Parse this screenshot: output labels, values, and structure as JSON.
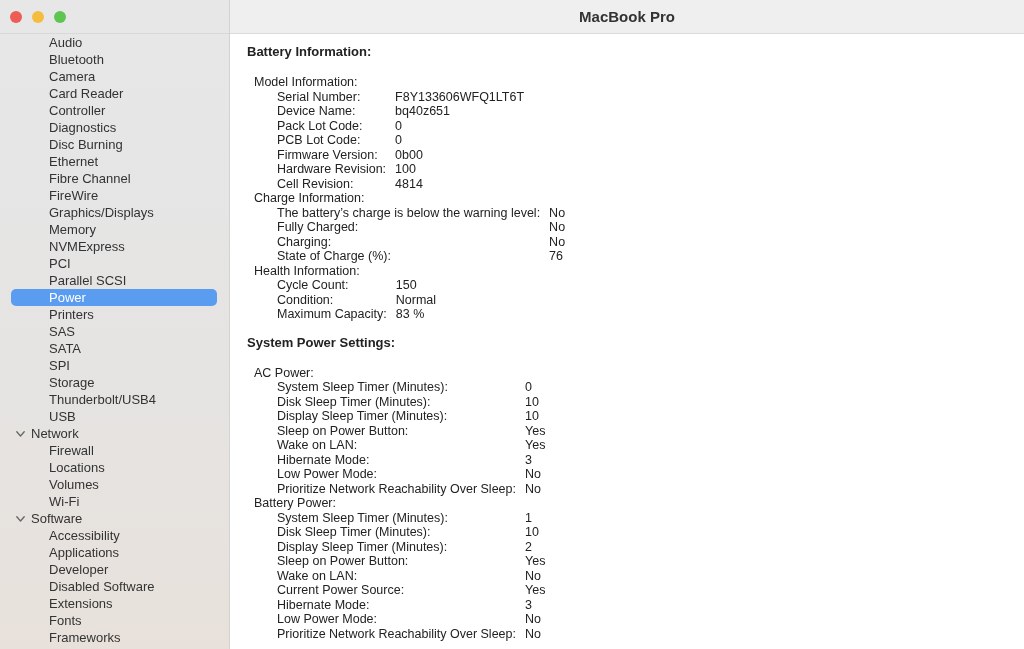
{
  "window": {
    "title": "MacBook Pro"
  },
  "sidebar": {
    "groups": [
      {
        "children": [
          {
            "label": "Audio",
            "selected": false
          },
          {
            "label": "Bluetooth",
            "selected": false
          },
          {
            "label": "Camera",
            "selected": false
          },
          {
            "label": "Card Reader",
            "selected": false
          },
          {
            "label": "Controller",
            "selected": false
          },
          {
            "label": "Diagnostics",
            "selected": false
          },
          {
            "label": "Disc Burning",
            "selected": false
          },
          {
            "label": "Ethernet",
            "selected": false
          },
          {
            "label": "Fibre Channel",
            "selected": false
          },
          {
            "label": "FireWire",
            "selected": false
          },
          {
            "label": "Graphics/Displays",
            "selected": false
          },
          {
            "label": "Memory",
            "selected": false
          },
          {
            "label": "NVMExpress",
            "selected": false
          },
          {
            "label": "PCI",
            "selected": false
          },
          {
            "label": "Parallel SCSI",
            "selected": false
          },
          {
            "label": "Power",
            "selected": true
          },
          {
            "label": "Printers",
            "selected": false
          },
          {
            "label": "SAS",
            "selected": false
          },
          {
            "label": "SATA",
            "selected": false
          },
          {
            "label": "SPI",
            "selected": false
          },
          {
            "label": "Storage",
            "selected": false
          },
          {
            "label": "Thunderbolt/USB4",
            "selected": false
          },
          {
            "label": "USB",
            "selected": false
          }
        ]
      },
      {
        "label": "Network",
        "selected": false,
        "expanded": true,
        "children": [
          {
            "label": "Firewall",
            "selected": false
          },
          {
            "label": "Locations",
            "selected": false
          },
          {
            "label": "Volumes",
            "selected": false
          },
          {
            "label": "Wi-Fi",
            "selected": false
          }
        ]
      },
      {
        "label": "Software",
        "selected": false,
        "expanded": true,
        "children": [
          {
            "label": "Accessibility",
            "selected": false
          },
          {
            "label": "Applications",
            "selected": false
          },
          {
            "label": "Developer",
            "selected": false
          },
          {
            "label": "Disabled Software",
            "selected": false
          },
          {
            "label": "Extensions",
            "selected": false
          },
          {
            "label": "Fonts",
            "selected": false
          },
          {
            "label": "Frameworks",
            "selected": false
          }
        ]
      }
    ]
  },
  "content": {
    "sections": [
      {
        "title": "Battery Information:",
        "groups": [
          {
            "title": "Model Information:",
            "rows": [
              {
                "label": "Serial Number:",
                "value": "F8Y133606WFQ1LT6T"
              },
              {
                "label": "Device Name:",
                "value": "bq40z651"
              },
              {
                "label": "Pack Lot Code:",
                "value": "0"
              },
              {
                "label": "PCB Lot Code:",
                "value": "0"
              },
              {
                "label": "Firmware Version:",
                "value": "0b00"
              },
              {
                "label": "Hardware Revision:",
                "value": "100"
              },
              {
                "label": "Cell Revision:",
                "value": "4814"
              }
            ]
          },
          {
            "title": "Charge Information:",
            "rows": [
              {
                "label": "The battery’s charge is below the warning level:",
                "value": "No"
              },
              {
                "label": "Fully Charged:",
                "value": "No"
              },
              {
                "label": "Charging:",
                "value": "No"
              },
              {
                "label": "State of Charge (%):",
                "value": "76"
              }
            ]
          },
          {
            "title": "Health Information:",
            "rows": [
              {
                "label": "Cycle Count:",
                "value": "150"
              },
              {
                "label": "Condition:",
                "value": "Normal"
              },
              {
                "label": "Maximum Capacity:",
                "value": "83 %"
              }
            ]
          }
        ]
      },
      {
        "title": "System Power Settings:",
        "groups": [
          {
            "title": "AC Power:",
            "rows": [
              {
                "label": "System Sleep Timer (Minutes):",
                "value": "0"
              },
              {
                "label": "Disk Sleep Timer (Minutes):",
                "value": "10"
              },
              {
                "label": "Display Sleep Timer (Minutes):",
                "value": "10"
              },
              {
                "label": "Sleep on Power Button:",
                "value": "Yes"
              },
              {
                "label": "Wake on LAN:",
                "value": "Yes"
              },
              {
                "label": "Hibernate Mode:",
                "value": "3"
              },
              {
                "label": "Low Power Mode:",
                "value": "No"
              },
              {
                "label": "Prioritize Network Reachability Over Sleep:",
                "value": "No"
              }
            ]
          },
          {
            "title": "Battery Power:",
            "rows": [
              {
                "label": "System Sleep Timer (Minutes):",
                "value": "1"
              },
              {
                "label": "Disk Sleep Timer (Minutes):",
                "value": "10"
              },
              {
                "label": "Display Sleep Timer (Minutes):",
                "value": "2"
              },
              {
                "label": "Sleep on Power Button:",
                "value": "Yes"
              },
              {
                "label": "Wake on LAN:",
                "value": "No"
              },
              {
                "label": "Current Power Source:",
                "value": "Yes"
              },
              {
                "label": "Hibernate Mode:",
                "value": "3"
              },
              {
                "label": "Low Power Mode:",
                "value": "No"
              },
              {
                "label": "Prioritize Network Reachability Over Sleep:",
                "value": "No"
              }
            ]
          }
        ]
      }
    ]
  }
}
